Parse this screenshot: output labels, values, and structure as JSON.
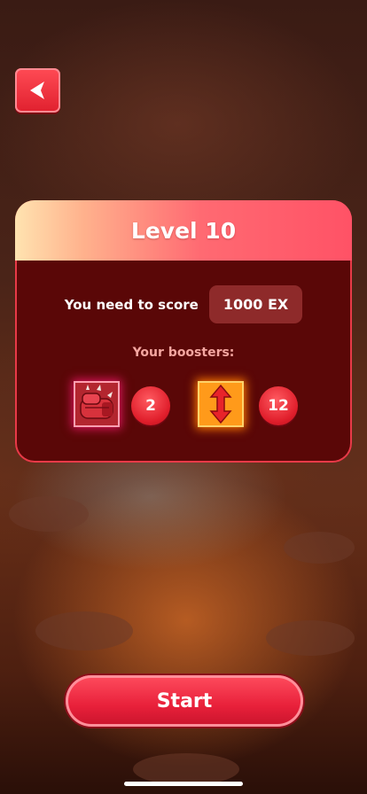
{
  "back_button": {
    "icon": "back-arrow-icon",
    "color": "#e8262f"
  },
  "level_card": {
    "title": "Level 10",
    "score_label": "You need to score",
    "score_value": "1000 EX",
    "boosters_label": "Your boosters:",
    "boosters": [
      {
        "icon": "boxing-glove-icon",
        "count": "2"
      },
      {
        "icon": "vertical-arrows-icon",
        "count": "12"
      }
    ]
  },
  "start_button": {
    "label": "Start"
  },
  "colors": {
    "accent": "#ff5266",
    "card_bg": "#5a0707",
    "score_pill_bg": "#8e2a2a",
    "boosters_label": "#f4a6a0"
  }
}
